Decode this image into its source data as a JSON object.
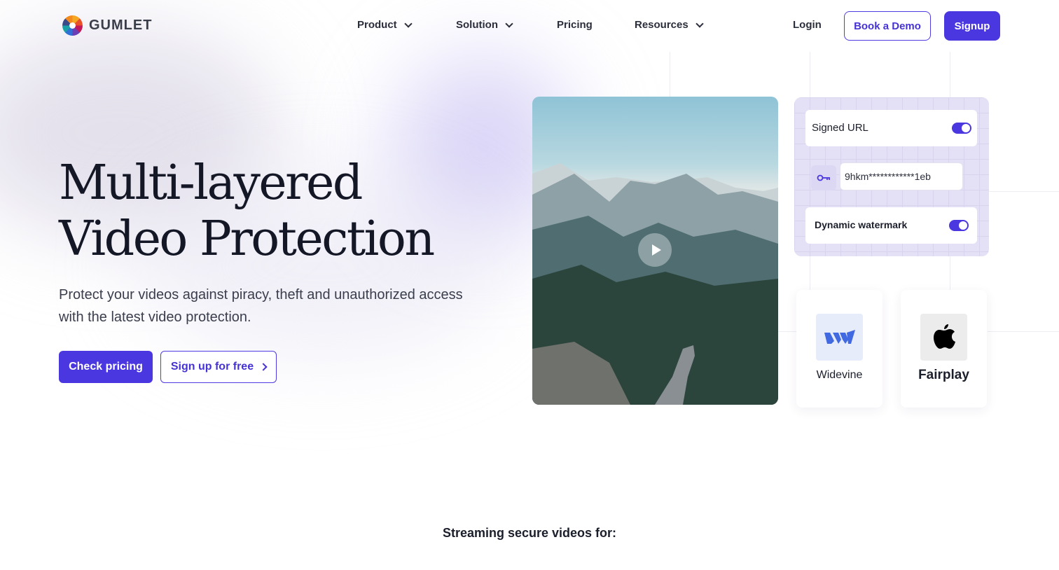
{
  "brand": {
    "name": "GUMLET"
  },
  "nav": {
    "items": [
      {
        "label": "Product",
        "has_dropdown": true
      },
      {
        "label": "Solution",
        "has_dropdown": true
      },
      {
        "label": "Pricing",
        "has_dropdown": false
      },
      {
        "label": "Resources",
        "has_dropdown": true
      }
    ],
    "login_label": "Login",
    "demo_label": "Book a Demo",
    "signup_label": "Signup"
  },
  "hero": {
    "title_line1": "Multi-layered",
    "title_line2": "Video Protection",
    "subtitle": "Protect your videos against piracy, theft and unauthorized access with the latest video protection.",
    "cta_primary": "Check pricing",
    "cta_secondary": "Sign up for free"
  },
  "protection": {
    "signed_url_label": "Signed URL",
    "signed_url_enabled": true,
    "key_value": "9hkm************1eb",
    "watermark_label": "Dynamic watermark",
    "watermark_enabled": true
  },
  "drm": [
    {
      "label": "Widevine",
      "icon": "widevine-icon"
    },
    {
      "label": "Fairplay",
      "icon": "apple-icon"
    }
  ],
  "streaming_heading": "Streaming secure videos for:",
  "colors": {
    "accent": "#4a37e0",
    "text": "#1b1e2b",
    "panel_bg": "#e4e1f6"
  }
}
